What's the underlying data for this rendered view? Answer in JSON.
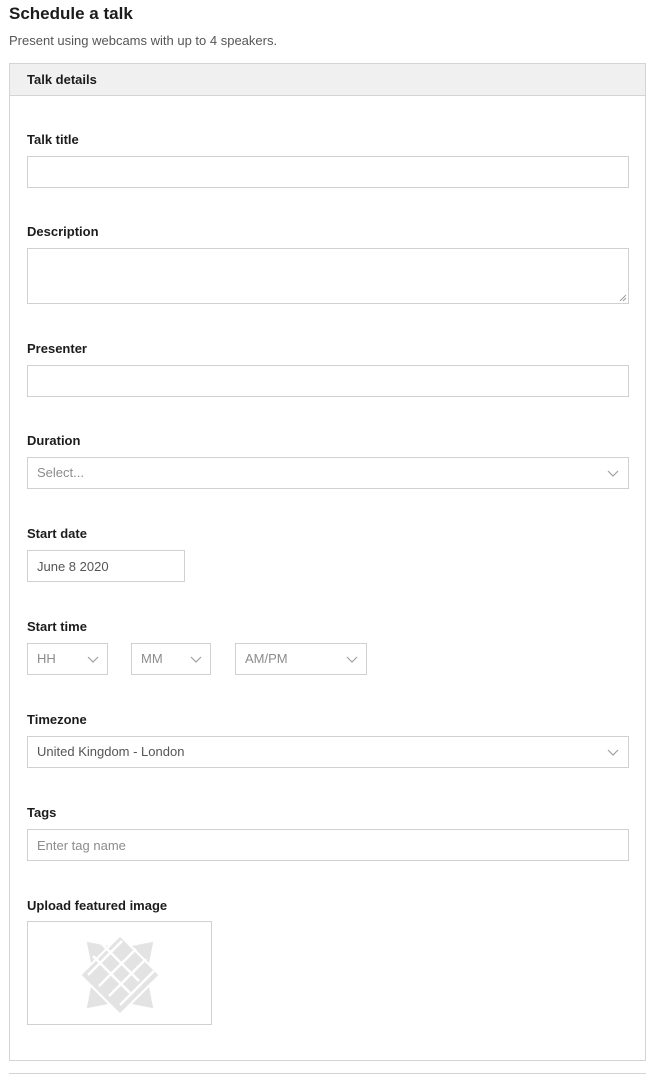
{
  "page": {
    "title": "Schedule a talk",
    "subtitle": "Present using webcams with up to 4 speakers."
  },
  "panel": {
    "header": "Talk details"
  },
  "form": {
    "talk_title": {
      "label": "Talk title",
      "value": ""
    },
    "description": {
      "label": "Description",
      "value": ""
    },
    "presenter": {
      "label": "Presenter",
      "value": ""
    },
    "duration": {
      "label": "Duration",
      "placeholder": "Select..."
    },
    "start_date": {
      "label": "Start date",
      "value": "June 8 2020"
    },
    "start_time": {
      "label": "Start time",
      "hour": "HH",
      "minute": "MM",
      "ampm": "AM/PM"
    },
    "timezone": {
      "label": "Timezone",
      "value": "United Kingdom - London"
    },
    "tags": {
      "label": "Tags",
      "placeholder": "Enter tag name"
    },
    "featured_image": {
      "label": "Upload featured image",
      "icon": "image-placeholder-icon"
    }
  },
  "colors": {
    "border": "#d0d0d0",
    "header_bg": "#f0f0f0",
    "placeholder_text": "#8c8c8c",
    "icon_gray": "#e3e3e3"
  }
}
